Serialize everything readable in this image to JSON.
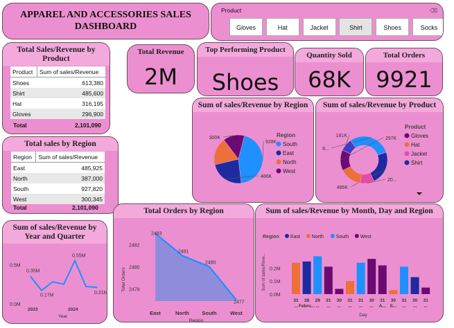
{
  "header": {
    "title_line1": "APPAREL AND ACCESSORIES SALES",
    "title_line2": "DASHBOARD"
  },
  "slicer": {
    "label": "Product",
    "options": [
      "Gloves",
      "Hat",
      "Jacket",
      "Shirt",
      "Shoes",
      "Socks"
    ],
    "selected": "Shirt"
  },
  "kpis": {
    "revenue": {
      "label": "Total Revenue",
      "value": "2M"
    },
    "top_product": {
      "label": "Top Performing Product",
      "value": "Shoes"
    },
    "quantity": {
      "label": "Quantity Sold",
      "value": "68K"
    },
    "orders": {
      "label": "Total Orders",
      "value": "9921"
    }
  },
  "sales_by_product": {
    "title": "Total Sales/Revenue by Product",
    "col1": "Product",
    "col2": "Sum of sales/Revenue",
    "rows": [
      {
        "name": "Shoes",
        "value": "613,380"
      },
      {
        "name": "Shirt",
        "value": "485,600"
      },
      {
        "name": "Hat",
        "value": "316,195"
      },
      {
        "name": "Gloves",
        "value": "296,900"
      }
    ],
    "total_label": "Total",
    "total_value": "2,101,090"
  },
  "sales_by_region": {
    "title": "Total sales by Region",
    "col1": "Region",
    "col2": "Sum of sales/Revenue",
    "rows": [
      {
        "name": "East",
        "value": "485,925"
      },
      {
        "name": "North",
        "value": "387,000"
      },
      {
        "name": "South",
        "value": "927,820"
      },
      {
        "name": "West",
        "value": "300,345"
      }
    ],
    "total_label": "Total",
    "total_value": "2,101,090"
  },
  "chart_data": [
    {
      "id": "pie_region",
      "type": "pie",
      "title": "Sum of sales/Revenue by Region",
      "legend_title": "Region",
      "slices": [
        {
          "name": "South",
          "value": 928,
          "label": "928K",
          "color": "#1e90ff"
        },
        {
          "name": "East",
          "value": 486,
          "label": "486K",
          "color": "#1c2ba0"
        },
        {
          "name": "North",
          "value": 387,
          "label": "",
          "color": "#ed6f3a"
        },
        {
          "name": "West",
          "value": 300,
          "label": "300K",
          "color": "#6b0a72"
        }
      ]
    },
    {
      "id": "donut_product",
      "type": "pie",
      "title": "Sum of sales/Revenue by Product",
      "legend_title": "Product",
      "slices": [
        {
          "name": "Shoes",
          "value": 613,
          "label": "6...",
          "color": "#1e90ff"
        },
        {
          "name": "Shirt",
          "value": 486,
          "label": "486K",
          "color": "#1c2ba0"
        },
        {
          "name": "Jacket",
          "value": 200,
          "label": "20...",
          "color": "#e64aa8"
        },
        {
          "name": "Hat",
          "value": 316,
          "label": "",
          "color": "#ed6f3a"
        },
        {
          "name": "Gloves",
          "value": 297,
          "label": "297K",
          "color": "#6b0a72"
        },
        {
          "name": "Socks",
          "value": 181,
          "label": "181K",
          "color": "#3c3fc4"
        }
      ],
      "legend": [
        {
          "name": "Gloves",
          "color": "#6b0a72"
        },
        {
          "name": "Hat",
          "color": "#ed6f3a"
        },
        {
          "name": "Jacket",
          "color": "#e64aa8"
        },
        {
          "name": "Shirt",
          "color": "#1c2ba0"
        }
      ]
    },
    {
      "id": "line_year",
      "type": "line",
      "title": "Sum of sales/Revenue by Year and Quarter",
      "xlabel": "Year",
      "x_ticks": [
        "2023",
        "2024"
      ],
      "y_ticks": [
        "0.5M",
        "0.0M"
      ],
      "values": [
        0.35,
        0.17,
        0.28,
        0.25,
        0.55,
        0.22,
        0.21
      ],
      "point_labels": [
        "0.35M",
        "0.17M",
        "",
        "",
        "0.55M",
        "",
        "0.21M"
      ],
      "ylim": [
        0,
        0.6
      ],
      "color": "#1e90ff"
    },
    {
      "id": "area_orders",
      "type": "area",
      "title": "Total Orders by Region",
      "xlabel": "Region",
      "ylabel": "Total Orders",
      "categories": [
        "East",
        "North",
        "South",
        "West"
      ],
      "values": [
        2483,
        2481,
        2480,
        2477
      ],
      "point_labels": [
        "2483",
        "2481",
        "2480",
        "2477"
      ],
      "y_ticks": [
        2482,
        2480,
        2478
      ],
      "ylim": [
        2476.9,
        2483.4
      ],
      "line_color": "#1e90ff",
      "fill_color": "#8f8ddb"
    },
    {
      "id": "bar_month",
      "type": "bar",
      "title": "Sum of sales/Revenue by Month, Day and Region",
      "legend_title": "Region",
      "legend": [
        {
          "name": "East",
          "color": "#1c2ba0"
        },
        {
          "name": "North",
          "color": "#ed6f3a"
        },
        {
          "name": "South",
          "color": "#1e90ff"
        },
        {
          "name": "West",
          "color": "#6b0a72"
        }
      ],
      "ylabel": "Sum of sales/Reve...",
      "xlabel": "Day",
      "y_ticks": [
        "0.2M",
        "0.1M",
        "0.0M"
      ],
      "ylim": [
        0,
        0.35
      ],
      "bars": [
        {
          "value": 0.24,
          "color": "#ed6f3a"
        },
        {
          "value": 0.25,
          "color": "#1c2ba0"
        },
        {
          "value": 0.29,
          "color": "#1e90ff"
        },
        {
          "value": 0.21,
          "color": "#6b0a72"
        },
        {
          "value": 0.04,
          "color": "#6b0a72"
        },
        {
          "value": 0.1,
          "color": "#ed6f3a"
        },
        {
          "value": 0.24,
          "color": "#1e90ff"
        },
        {
          "value": 0.27,
          "color": "#6b0a72"
        },
        {
          "value": 0.22,
          "color": "#6b0a72"
        },
        {
          "value": 0.03,
          "color": "#ed6f3a"
        },
        {
          "value": 0.21,
          "color": "#1e90ff"
        },
        {
          "value": 0.13,
          "color": "#1c2ba0"
        },
        {
          "value": 0.05,
          "color": "#6b0a72"
        }
      ],
      "x_labels": [
        "31 ...",
        "28 Febru...",
        "29 ...",
        "31 ...",
        "30 ...",
        "31 ...",
        "31 ...",
        "30 ...",
        "31 A...",
        "30 S...",
        "31 ...",
        "30 ...",
        "31 ..."
      ]
    }
  ]
}
